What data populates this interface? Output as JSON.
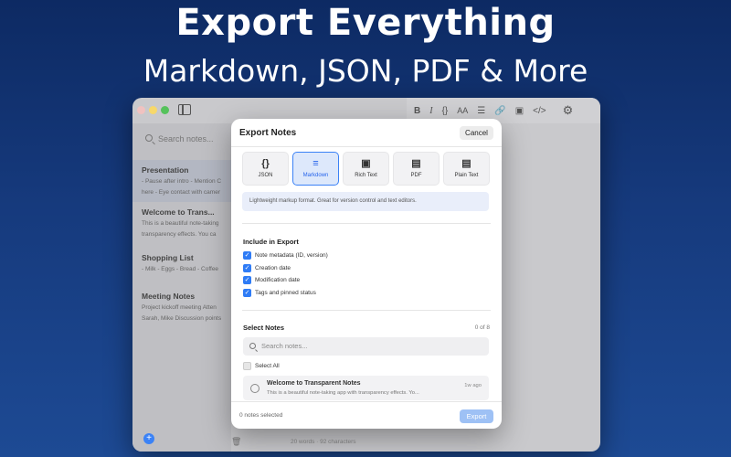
{
  "hero": {
    "title": "Export Everything",
    "subtitle": "Markdown, JSON, PDF & More"
  },
  "sidebar": {
    "search_placeholder": "Search notes...",
    "notes": [
      {
        "title": "Presentation",
        "preview1": "- Pause after intro - Mention C",
        "preview2": "here - Eye contact with camer",
        "selected": true
      },
      {
        "title": "Welcome to Trans...",
        "preview1": "This is a beautiful note-taking",
        "preview2": "transparency effects.  You ca",
        "selected": false
      },
      {
        "title": "Shopping List",
        "preview1": "- Milk - Eggs - Bread - Coffee",
        "preview2": "",
        "selected": false
      },
      {
        "title": "Meeting Notes",
        "preview1": "Project kickoff meeting  Atten",
        "preview2": "Sarah, Mike  Discussion points",
        "selected": false
      }
    ],
    "add_label": "+"
  },
  "toolbar": {
    "bold": "B",
    "italic": "I",
    "code": "{}",
    "font_size": "AA",
    "list": "☰",
    "link": "🔗",
    "image": "▣",
    "html": "</>",
    "settings": "⚙"
  },
  "editor": {
    "word_count": "20 words · 92 characters"
  },
  "modal": {
    "title": "Export Notes",
    "cancel": "Cancel",
    "formats": [
      {
        "icon": "{}",
        "label": "JSON",
        "active": false
      },
      {
        "icon": "≡",
        "label": "Markdown",
        "active": true
      },
      {
        "icon": "▣",
        "label": "Rich Text",
        "active": false
      },
      {
        "icon": "▤",
        "label": "PDF",
        "active": false
      },
      {
        "icon": "▤",
        "label": "Plain Text",
        "active": false
      }
    ],
    "description": "Lightweight markup format. Great for version control and text editors.",
    "include_title": "Include in Export",
    "options": [
      {
        "label": "Note metadata (ID, version)",
        "checked": true
      },
      {
        "label": "Creation date",
        "checked": true
      },
      {
        "label": "Modification date",
        "checked": true
      },
      {
        "label": "Tags and pinned status",
        "checked": true
      }
    ],
    "select_title": "Select Notes",
    "count": "0 of 8",
    "search_placeholder": "Search notes...",
    "select_all": "Select All",
    "note_items": [
      {
        "title": "Welcome to Transparent Notes",
        "preview": "This is a beautiful note-taking app with transparency effects.  Yo...",
        "time": "1w ago"
      }
    ],
    "selected_count": "0 notes selected",
    "export": "Export"
  }
}
